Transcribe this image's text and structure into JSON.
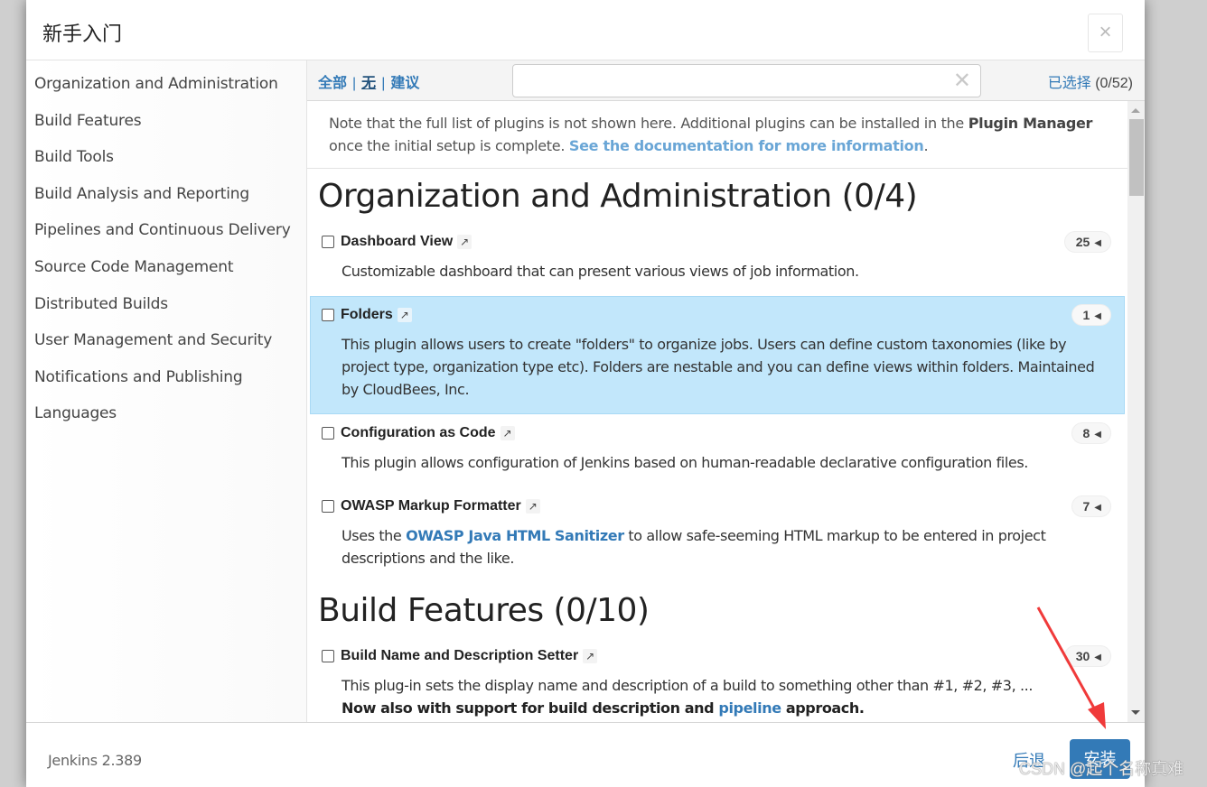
{
  "modal": {
    "title": "新手入门",
    "close_label": "×"
  },
  "sidebar": {
    "items": [
      {
        "label": "Organization and Administration"
      },
      {
        "label": "Build Features"
      },
      {
        "label": "Build Tools"
      },
      {
        "label": "Build Analysis and Reporting"
      },
      {
        "label": "Pipelines and Continuous Delivery"
      },
      {
        "label": "Source Code Management"
      },
      {
        "label": "Distributed Builds"
      },
      {
        "label": "User Management and Security"
      },
      {
        "label": "Notifications and Publishing"
      },
      {
        "label": "Languages"
      }
    ]
  },
  "toolbar": {
    "filter_all": "全部",
    "filter_none": "无",
    "filter_suggested": "建议",
    "separator": "|",
    "search_value": "",
    "search_placeholder": "",
    "clear_icon": "✕",
    "selected_label": "已选择",
    "selected_count": "(0/52)"
  },
  "note": {
    "text_before": "Note that the full list of plugins is not shown here. Additional plugins can be installed in the ",
    "plugin_manager": "Plugin Manager",
    "text_after": " once the initial setup is complete. ",
    "doc_link": "See the documentation for more information",
    "period": "."
  },
  "sections": [
    {
      "title": "Organization and Administration (0/4)",
      "plugins": [
        {
          "name": "Dashboard View",
          "deps": "25",
          "description": "Customizable dashboard that can present various views of job information.",
          "highlighted": false
        },
        {
          "name": "Folders",
          "deps": "1",
          "description": "This plugin allows users to create \"folders\" to organize jobs. Users can define custom taxonomies (like by project type, organization type etc). Folders are nestable and you can define views within folders. Maintained by CloudBees, Inc.",
          "highlighted": true
        },
        {
          "name": "Configuration as Code",
          "deps": "8",
          "description": "This plugin allows configuration of Jenkins based on human-readable declarative configuration files.",
          "highlighted": false
        },
        {
          "name": "OWASP Markup Formatter",
          "deps": "7",
          "desc_before": "Uses the ",
          "desc_link": "OWASP Java HTML Sanitizer",
          "desc_after": " to allow safe-seeming HTML markup to be entered in project descriptions and the like.",
          "highlighted": false
        }
      ]
    },
    {
      "title": "Build Features (0/10)",
      "plugins": [
        {
          "name": "Build Name and Description Setter",
          "deps": "30",
          "description": "This plug-in sets the display name and description of a build to something other than #1, #2, #3, ...",
          "strong_before": "Now also with support for build description and ",
          "strong_link": "pipeline",
          "strong_after": " approach.",
          "highlighted": false
        }
      ]
    }
  ],
  "icons": {
    "external_link": "↗",
    "deps_toggle": "◀"
  },
  "footer": {
    "version": "Jenkins 2.389",
    "back_label": "后退",
    "install_label": "安装"
  },
  "watermark": "CSDN @起个名称真难",
  "colors": {
    "accent": "#337ab7",
    "highlight_row": "#c2e7fb",
    "annotation_arrow": "#f03a3a"
  }
}
